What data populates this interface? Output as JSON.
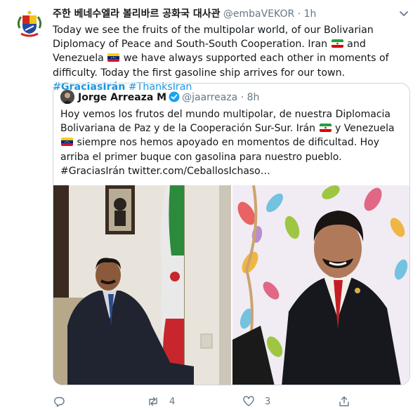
{
  "tweet": {
    "author_name": "주한 베네수엘라 볼리바르 공화국 대사관",
    "handle": "@embaVEKOR",
    "separator": "·",
    "time": "1h",
    "text_1": "Today we see the fruits of the multipolar world, of our Bolivarian Diplomacy of Peace and South-South Cooperation. Iran",
    "text_2": "and Venezuela",
    "text_3": "we have always supported each other in moments of difficulty. Today the first gasoline ship arrives for our town.",
    "hashtag_1": "#GraciasIrán",
    "hashtag_2": "#ThanksIran"
  },
  "quoted": {
    "author_name": "Jorge Arreaza M",
    "handle": "@jaarreaza",
    "separator": "·",
    "time": "8h",
    "text_1": "Hoy vemos los frutos del mundo multipolar, de nuestra Diplomacia Bolivariana de Paz y de la Cooperación Sur-Sur. Irán",
    "text_2": "y Venezuela",
    "text_3": "siempre nos hemos apoyado en momentos de dificultad. Hoy arriba el primer buque con gasolina para nuestro pueblo. #GraciasIrán twitter.com/CeballosIchaso…"
  },
  "actions": {
    "reply_count": "",
    "retweet_count": "4",
    "like_count": "3",
    "share_count": ""
  },
  "colors": {
    "link": "#1b95e0",
    "muted": "#657786",
    "border": "#ccd6dd"
  }
}
